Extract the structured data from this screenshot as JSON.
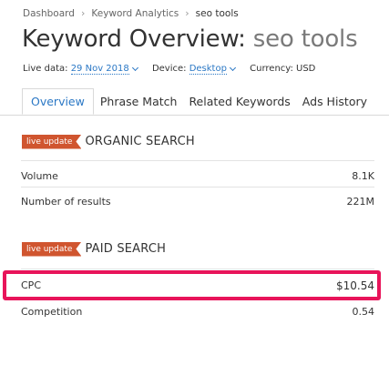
{
  "breadcrumb": {
    "items": [
      "Dashboard",
      "Keyword Analytics",
      "seo tools"
    ]
  },
  "header": {
    "title_prefix": "Keyword Overview: ",
    "query": "seo tools"
  },
  "meta": {
    "live_data_label": "Live data:",
    "live_data_value": "29 Nov 2018",
    "device_label": "Device:",
    "device_value": "Desktop",
    "currency": "Currency: USD"
  },
  "tabs": [
    {
      "label": "Overview",
      "active": true
    },
    {
      "label": "Phrase Match",
      "active": false
    },
    {
      "label": "Related Keywords",
      "active": false
    },
    {
      "label": "Ads History",
      "active": false
    }
  ],
  "organic": {
    "badge": "live update",
    "title": "ORGANIC SEARCH",
    "rows": [
      {
        "label": "Volume",
        "value": "8.1K"
      },
      {
        "label": "Number of results",
        "value": "221M"
      }
    ]
  },
  "paid": {
    "badge": "live update",
    "title": "PAID SEARCH",
    "rows": [
      {
        "label": "CPC",
        "value": "$10.54"
      },
      {
        "label": "Competition",
        "value": "0.54"
      }
    ]
  },
  "colors": {
    "accent": "#2b78c5",
    "badge": "#d0552f",
    "highlight": "#e8145a"
  }
}
